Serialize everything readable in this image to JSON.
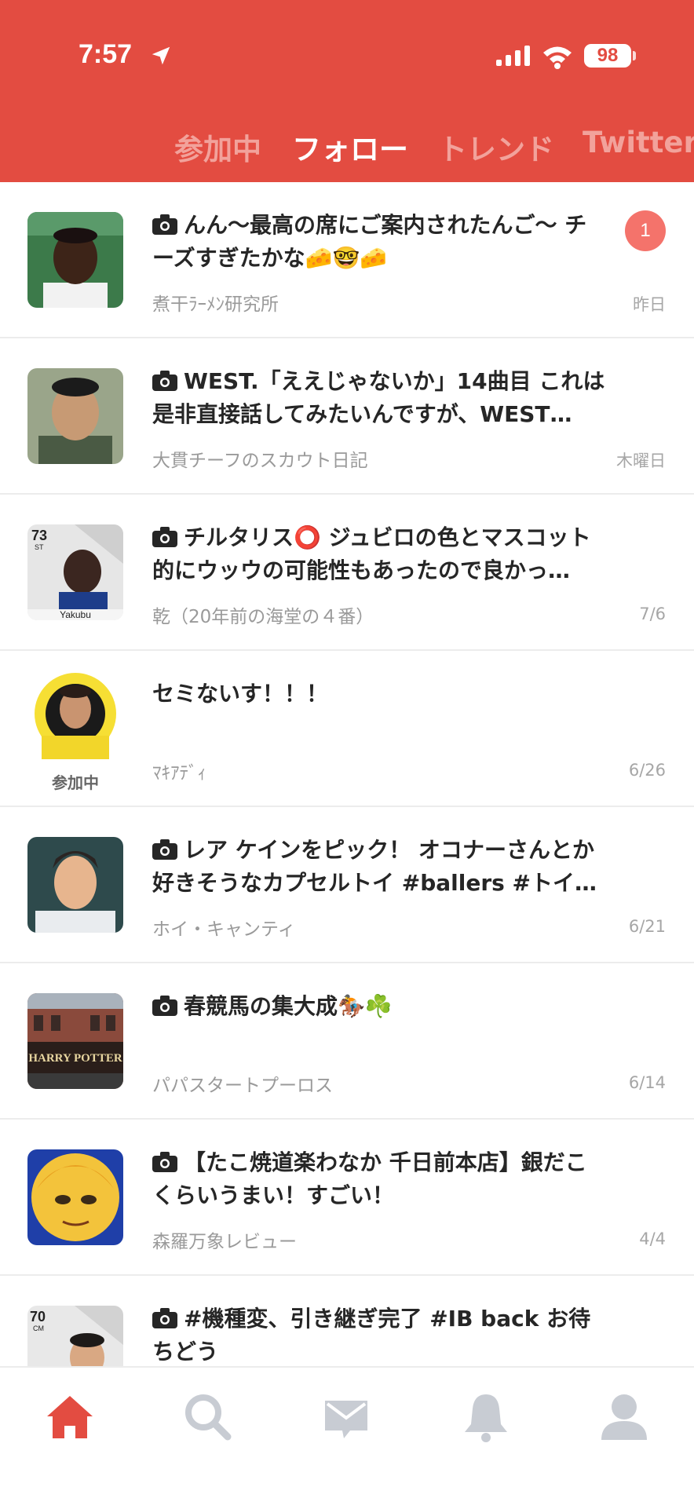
{
  "status_bar": {
    "time": "7:57",
    "battery": "98"
  },
  "top_tabs": [
    {
      "label": "参加中",
      "active": false
    },
    {
      "label": "フォロー",
      "active": true
    },
    {
      "label": "トレンド",
      "active": false
    },
    {
      "label": "Twitter",
      "active": false
    }
  ],
  "feed": [
    {
      "title": "んん〜最高の席にご案内されたんご〜 チーズすぎたかな🧀🤓🧀",
      "author": "煮干ﾗｰﾒﾝ研究所",
      "date": "昨日",
      "unread": "1",
      "has_photo": true
    },
    {
      "title": "WEST.「ええじゃないか」14曲目 これは是非直接話してみたいんですが、WEST…",
      "author": "大貫チーフのスカウト日記",
      "date": "木曜日",
      "has_photo": true
    },
    {
      "title": "チルタリス⭕️ ジュビロの色とマスコット的にウッウの可能性もあったので良かっ…",
      "author": "乾（20年前の海堂の４番）",
      "date": "7/6",
      "has_photo": true,
      "avatar_card": {
        "rating": "73",
        "position": "ST",
        "name": "Yakubu"
      }
    },
    {
      "title": "セミないす！！！",
      "author": "ﾏｷｱﾃﾞｨ",
      "date": "6/26",
      "has_photo": false,
      "participating_label": "参加中"
    },
    {
      "title": "レア ケインをピック！ オコナーさんとか好きそうなカプセルトイ #ballers #トイ…",
      "author": "ホイ・キャンティ",
      "date": "6/21",
      "has_photo": true
    },
    {
      "title": "春競馬の集大成🏇☘️",
      "author": "パパスタートプーロス",
      "date": "6/14",
      "has_photo": true,
      "avatar_text": "HARRY POTTER"
    },
    {
      "title": "【たこ焼道楽わなか 千日前本店】銀だこくらいうまい！すごい！",
      "author": "森羅万象レビュー",
      "date": "4/4",
      "has_photo": true
    },
    {
      "title": "#機種変、引き継ぎ完了 #IB back お待ちどう",
      "author": "",
      "date": "",
      "has_photo": true,
      "avatar_card": {
        "rating": "70",
        "position": "CM",
        "name": ""
      }
    }
  ],
  "bottom_nav": [
    {
      "icon": "home-icon",
      "active": true
    },
    {
      "icon": "search-icon",
      "active": false
    },
    {
      "icon": "mail-icon",
      "active": false
    },
    {
      "icon": "bell-icon",
      "active": false
    },
    {
      "icon": "profile-icon",
      "active": false
    }
  ],
  "colors": {
    "brand": "#e34c41",
    "inactive_tab": "#f2a29b",
    "badge": "#f4736b",
    "nav_inactive": "#c8ccd3"
  }
}
